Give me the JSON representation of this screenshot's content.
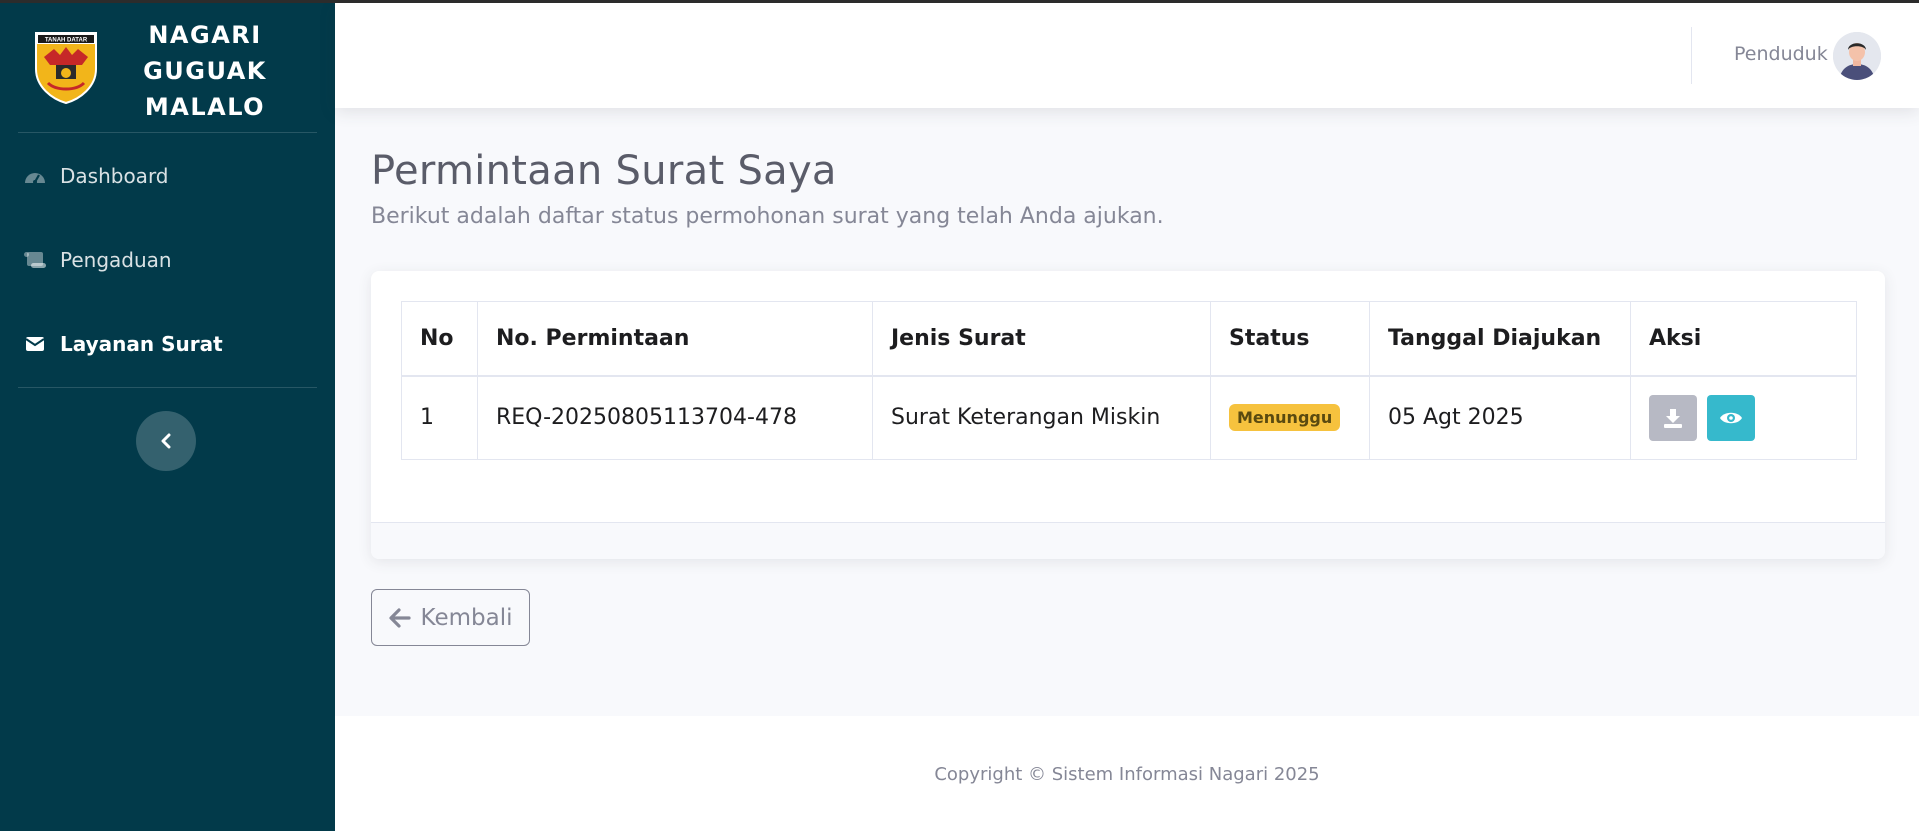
{
  "brand": {
    "logo_text": "TANAH DATAR",
    "name_line1": "NAGARI",
    "name_line2": "GUGUAK",
    "name_line3": "MALALO"
  },
  "sidebar": {
    "items": [
      {
        "label": "Dashboard",
        "icon": "tachometer-icon"
      },
      {
        "label": "Pengaduan",
        "icon": "scroll-icon"
      },
      {
        "label": "Layanan Surat",
        "icon": "envelope-icon",
        "active": true
      }
    ],
    "toggle_icon": "chevron-left-icon"
  },
  "topbar": {
    "user_name": "Penduduk",
    "avatar_icon": "user-avatar"
  },
  "page": {
    "title": "Permintaan Surat Saya",
    "subtitle": "Berikut adalah daftar status permohonan surat yang telah Anda ajukan."
  },
  "table": {
    "headers": [
      "No",
      "No. Permintaan",
      "Jenis Surat",
      "Status",
      "Tanggal Diajukan",
      "Aksi"
    ],
    "rows": [
      {
        "no": "1",
        "request_no": "REQ-20250805113704-478",
        "type": "Surat Keterangan Miskin",
        "status": "Menunggu",
        "date": "05 Agt 2025"
      }
    ]
  },
  "actions": {
    "back_label": "Kembali",
    "back_icon": "arrow-left-icon",
    "download_icon": "download-icon",
    "view_icon": "eye-icon"
  },
  "footer": {
    "copyright": "Copyright © Sistem Informasi Nagari 2025"
  },
  "colors": {
    "sidebar_bg": "#023a4a",
    "badge_warning": "#f6c23e",
    "view_button": "#36b9cc",
    "download_button": "#b7b9c4"
  }
}
